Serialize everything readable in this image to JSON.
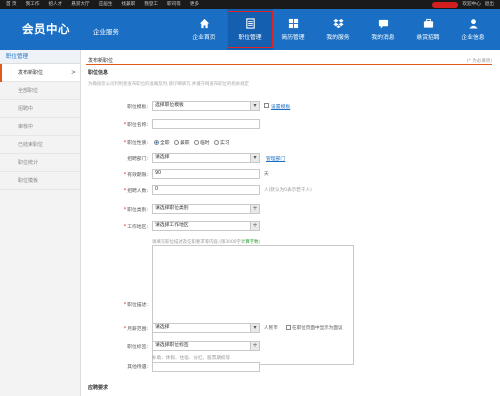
{
  "topbar": {
    "links": [
      "首 页",
      "我工作",
      "招人才",
      "悬赏大厅",
      "应届生",
      "找兼职",
      "我登工",
      "职司等",
      "更多"
    ],
    "user_suffix": "欢迎中心",
    "logout": "退出"
  },
  "header": {
    "logo": "会员中心",
    "subtitle": "企业服务",
    "nav": [
      {
        "label": "企业首页",
        "icon": "home-icon"
      },
      {
        "label": "职位管理",
        "icon": "list-icon"
      },
      {
        "label": "简历管理",
        "icon": "grid-icon"
      },
      {
        "label": "我的服务",
        "icon": "dropbox-icon"
      },
      {
        "label": "我的消息",
        "icon": "message-icon"
      },
      {
        "label": "悬赏招聘",
        "icon": "briefcase-icon"
      },
      {
        "label": "企业信息",
        "icon": "user-icon"
      }
    ],
    "active_nav_index": 1,
    "accent": "#1a6fc4"
  },
  "sidebar": {
    "title": "职位管理",
    "items": [
      "发布新职位",
      "全部职位",
      "招聘中",
      "审核中",
      "已结束职位",
      "职位统计",
      "职位模板"
    ],
    "active_index": 0
  },
  "main": {
    "title": "发布新职位",
    "tip": "(* 为必填项)",
    "section": "职位信息",
    "note": "为确保您公司利利使发布职位的准确及时,请仔细填写,并遵守网发布职位的相关规定",
    "fields": {
      "template": {
        "label": "职位模板:",
        "value": "选择职位模板",
        "link": "设置模板"
      },
      "name": {
        "label": "职位名称:"
      },
      "nature": {
        "label": "职位性质:",
        "options": [
          "全职",
          "兼职",
          "临时",
          "实习"
        ]
      },
      "dept": {
        "label": "招聘部门:",
        "value": "请选择",
        "link": "管理部门"
      },
      "valid": {
        "label": "有效期限:",
        "value": "90",
        "unit": "天"
      },
      "count": {
        "label": "招聘人数:",
        "value": "0",
        "hint": "人(默认为0表示若干人)"
      },
      "category": {
        "label": "职位类别:",
        "value": "请选择职位类别"
      },
      "area": {
        "label": "工作地区:",
        "value": "请选择工作地区"
      },
      "desc": {
        "label": "职位描述:",
        "placeholder": "请填写职位描述及任职要求等内容,(限3000字",
        "placeholder_green": "计算字数",
        "placeholder_end": ")"
      },
      "salary": {
        "label": "月薪范围:",
        "value": "请选择",
        "unit": "人民币",
        "check": "在职位页面中显示为面议"
      },
      "tag": {
        "label": "职位标签:",
        "value": "请选择职位标签"
      },
      "welfare": {
        "label": "其他待遇:",
        "hint": "补助、休假、住宿、分红、股票期权等"
      }
    },
    "section2": "应聘要求"
  }
}
